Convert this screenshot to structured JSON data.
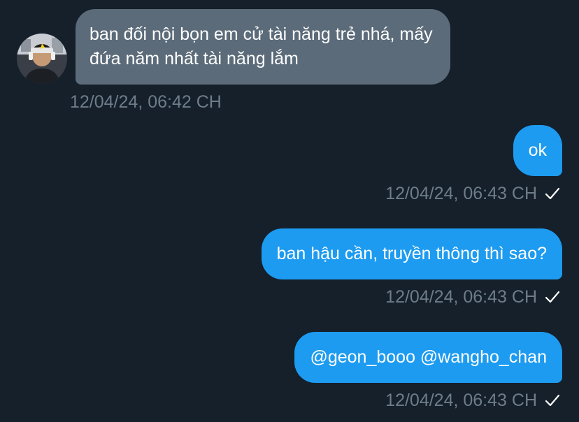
{
  "conversation": {
    "incoming": {
      "text": "ban đối nội bọn em cử tài năng trẻ nhá, mấy đứa năm nhất tài năng lắm",
      "timestamp": "12/04/24, 06:42 CH"
    },
    "outgoing": [
      {
        "text": "ok",
        "timestamp": "12/04/24, 06:43 CH",
        "status_icon": "check-icon"
      },
      {
        "text": "ban hậu cần, truyền thông thì sao?",
        "timestamp": "12/04/24, 06:43 CH",
        "status_icon": "check-icon"
      },
      {
        "text": "@geon_booo @wangho_chan",
        "timestamp": "12/04/24, 06:43 CH",
        "status_icon": "check-icon"
      }
    ]
  },
  "colors": {
    "background": "#15202b",
    "incoming_bubble": "#5b6b79",
    "outgoing_bubble": "#1d9bf0",
    "timestamp": "#6e7d8a",
    "text": "#ffffff"
  }
}
